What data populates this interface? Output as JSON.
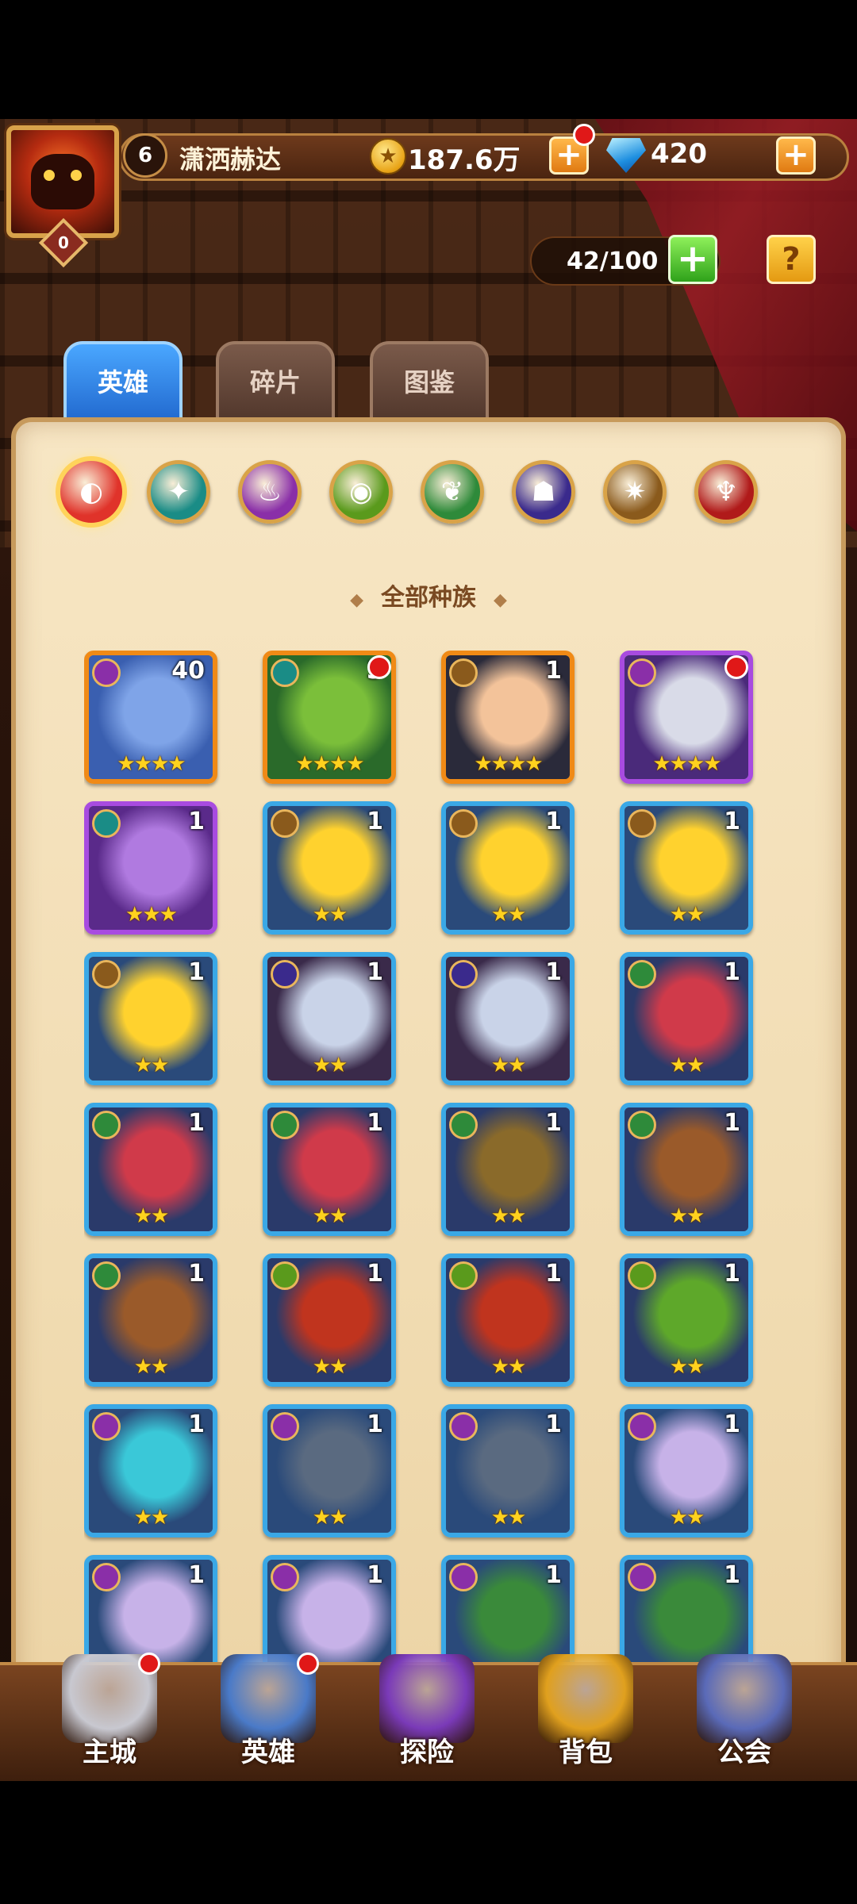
{
  "player": {
    "level": "6",
    "name": "潇洒赫达",
    "avatar_badge": "0"
  },
  "currency": {
    "gold": "187.6万",
    "gems": "420"
  },
  "hero_capacity": "42/100",
  "tabs": [
    {
      "label": "英雄",
      "active": true
    },
    {
      "label": "碎片",
      "active": false
    },
    {
      "label": "图鉴",
      "active": false
    }
  ],
  "race_filters": [
    {
      "name": "all-races",
      "color": "#e0332a",
      "glyph": "◐"
    },
    {
      "name": "race-sea",
      "color": "#1a8c86",
      "glyph": "✦"
    },
    {
      "name": "race-undead",
      "color": "#8a2fa8",
      "glyph": "♨"
    },
    {
      "name": "race-human",
      "color": "#5a9a1c",
      "glyph": "◉"
    },
    {
      "name": "race-nature",
      "color": "#2e8a3a",
      "glyph": "❦"
    },
    {
      "name": "race-demon",
      "color": "#3a2a8c",
      "glyph": "☗"
    },
    {
      "name": "race-mech",
      "color": "#8a5a1c",
      "glyph": "✷"
    },
    {
      "name": "race-dragon",
      "color": "#b01a1a",
      "glyph": "♆"
    }
  ],
  "race_title": "全部种族",
  "heroes": [
    {
      "count": "40",
      "stars": "★★★★",
      "frame": "orange",
      "race": "race-undead",
      "race_color": "#8a2fa8",
      "bg": "#3a5fb0",
      "fg": "#7fa4e8",
      "dot": false
    },
    {
      "count": "3",
      "stars": "★★★★",
      "frame": "orange",
      "race": "race-sea",
      "race_color": "#1a8c86",
      "bg": "#2a6a2a",
      "fg": "#7bbf3a",
      "dot": true
    },
    {
      "count": "1",
      "stars": "★★★★",
      "frame": "orange",
      "race": "race-mech",
      "race_color": "#8a5a1c",
      "bg": "#2a2a3a",
      "fg": "#f3c39a",
      "dot": false
    },
    {
      "count": "",
      "stars": "★★★★",
      "frame": "purple",
      "race": "race-undead",
      "race_color": "#8a2fa8",
      "bg": "#4a2a7a",
      "fg": "#d9dbe8",
      "dot": true
    },
    {
      "count": "1",
      "stars": "★★★",
      "frame": "purple",
      "race": "race-sea",
      "race_color": "#1a8c86",
      "bg": "#5a2a8a",
      "fg": "#b07ae0",
      "dot": false
    },
    {
      "count": "1",
      "stars": "★★",
      "frame": "blue",
      "race": "race-mech",
      "race_color": "#8a5a1c",
      "bg": "#2a4a7a",
      "fg": "#ffd22e",
      "dot": false
    },
    {
      "count": "1",
      "stars": "★★",
      "frame": "blue",
      "race": "race-mech",
      "race_color": "#8a5a1c",
      "bg": "#2a4a7a",
      "fg": "#ffd22e",
      "dot": false
    },
    {
      "count": "1",
      "stars": "★★",
      "frame": "blue",
      "race": "race-mech",
      "race_color": "#8a5a1c",
      "bg": "#2a4a7a",
      "fg": "#ffd22e",
      "dot": false
    },
    {
      "count": "1",
      "stars": "★★",
      "frame": "blue",
      "race": "race-mech",
      "race_color": "#8a5a1c",
      "bg": "#2a4a7a",
      "fg": "#ffd22e",
      "dot": false
    },
    {
      "count": "1",
      "stars": "★★",
      "frame": "blue",
      "race": "race-demon",
      "race_color": "#3a2a8c",
      "bg": "#3a2a4a",
      "fg": "#c9d3e8",
      "dot": false
    },
    {
      "count": "1",
      "stars": "★★",
      "frame": "blue",
      "race": "race-demon",
      "race_color": "#3a2a8c",
      "bg": "#3a2a4a",
      "fg": "#c9d3e8",
      "dot": false
    },
    {
      "count": "1",
      "stars": "★★",
      "frame": "blue",
      "race": "race-nature",
      "race_color": "#2e8a3a",
      "bg": "#2a3a6a",
      "fg": "#d03a4a",
      "dot": false
    },
    {
      "count": "1",
      "stars": "★★",
      "frame": "blue",
      "race": "race-nature",
      "race_color": "#2e8a3a",
      "bg": "#2a3a6a",
      "fg": "#d03a4a",
      "dot": false
    },
    {
      "count": "1",
      "stars": "★★",
      "frame": "blue",
      "race": "race-nature",
      "race_color": "#2e8a3a",
      "bg": "#2a3a6a",
      "fg": "#d03a4a",
      "dot": false
    },
    {
      "count": "1",
      "stars": "★★",
      "frame": "blue",
      "race": "race-nature",
      "race_color": "#2e8a3a",
      "bg": "#2a3a6a",
      "fg": "#8a6a2a",
      "dot": false
    },
    {
      "count": "1",
      "stars": "★★",
      "frame": "blue",
      "race": "race-nature",
      "race_color": "#2e8a3a",
      "bg": "#2a3a6a",
      "fg": "#9a5a2a",
      "dot": false
    },
    {
      "count": "1",
      "stars": "★★",
      "frame": "blue",
      "race": "race-nature",
      "race_color": "#2e8a3a",
      "bg": "#2a3a6a",
      "fg": "#9a5a2a",
      "dot": false
    },
    {
      "count": "1",
      "stars": "★★",
      "frame": "blue",
      "race": "race-human",
      "race_color": "#5a9a1c",
      "bg": "#2a3a6a",
      "fg": "#c0341e",
      "dot": false
    },
    {
      "count": "1",
      "stars": "★★",
      "frame": "blue",
      "race": "race-human",
      "race_color": "#5a9a1c",
      "bg": "#2a3a6a",
      "fg": "#c0341e",
      "dot": false
    },
    {
      "count": "1",
      "stars": "★★",
      "frame": "blue",
      "race": "race-human",
      "race_color": "#5a9a1c",
      "bg": "#2a3a6a",
      "fg": "#5ea82a",
      "dot": false
    },
    {
      "count": "1",
      "stars": "★★",
      "frame": "blue",
      "race": "race-undead",
      "race_color": "#8a2fa8",
      "bg": "#2a4a7a",
      "fg": "#3ac8d8",
      "dot": false
    },
    {
      "count": "1",
      "stars": "★★",
      "frame": "blue",
      "race": "race-undead",
      "race_color": "#8a2fa8",
      "bg": "#2a4a7a",
      "fg": "#5a6a80",
      "dot": false
    },
    {
      "count": "1",
      "stars": "★★",
      "frame": "blue",
      "race": "race-undead",
      "race_color": "#8a2fa8",
      "bg": "#2a4a7a",
      "fg": "#5a6a80",
      "dot": false
    },
    {
      "count": "1",
      "stars": "★★",
      "frame": "blue",
      "race": "race-undead",
      "race_color": "#8a2fa8",
      "bg": "#2a4a7a",
      "fg": "#c7b2e8",
      "dot": false
    },
    {
      "count": "1",
      "stars": "",
      "frame": "blue",
      "race": "race-undead",
      "race_color": "#8a2fa8",
      "bg": "#2a4a7a",
      "fg": "#c7b2e8",
      "dot": false
    },
    {
      "count": "1",
      "stars": "",
      "frame": "blue",
      "race": "race-undead",
      "race_color": "#8a2fa8",
      "bg": "#2a4a7a",
      "fg": "#c7b2e8",
      "dot": false
    },
    {
      "count": "1",
      "stars": "",
      "frame": "blue",
      "race": "race-undead",
      "race_color": "#8a2fa8",
      "bg": "#2a4a7a",
      "fg": "#3a8a3a",
      "dot": false
    },
    {
      "count": "1",
      "stars": "",
      "frame": "blue",
      "race": "race-undead",
      "race_color": "#8a2fa8",
      "bg": "#2a4a7a",
      "fg": "#3a8a3a",
      "dot": false
    }
  ],
  "nav": [
    {
      "label": "主城",
      "icon": "castle-icon",
      "color": "#c8c8d0",
      "dot": true
    },
    {
      "label": "英雄",
      "icon": "hero-icon",
      "color": "#4a7ac8",
      "dot": true
    },
    {
      "label": "探险",
      "icon": "portal-icon",
      "color": "#7a3ab8",
      "dot": false
    },
    {
      "label": "背包",
      "icon": "bag-icon",
      "color": "#e0a01e",
      "dot": false
    },
    {
      "label": "公会",
      "icon": "guild-icon",
      "color": "#5a6ab8",
      "dot": false
    }
  ]
}
